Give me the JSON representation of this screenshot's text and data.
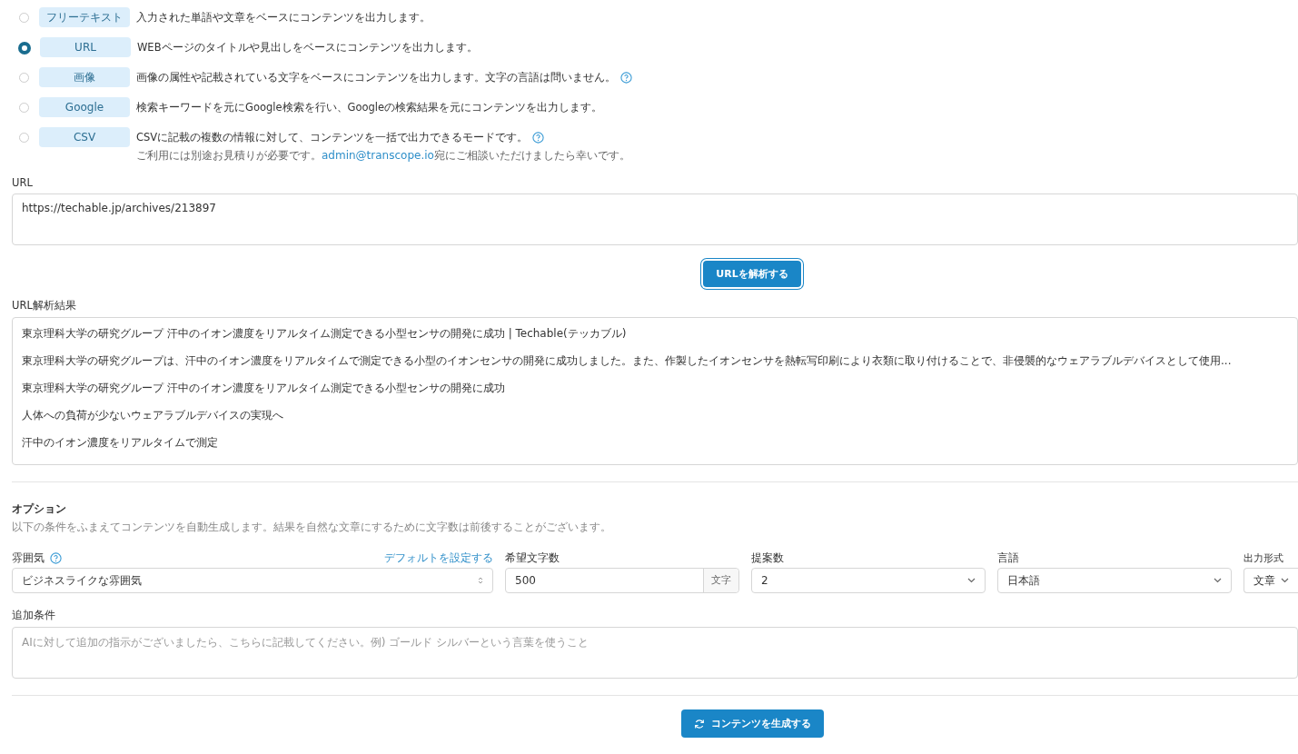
{
  "modes": [
    {
      "label": "フリーテキスト",
      "description": "入力された単語や文章をベースにコンテンツを出力します。",
      "selected": false,
      "help": false
    },
    {
      "label": "URL",
      "description": "WEBページのタイトルや見出しをベースにコンテンツを出力します。",
      "selected": true,
      "help": false
    },
    {
      "label": "画像",
      "description": "画像の属性や記載されている文字をベースにコンテンツを出力します。文字の言語は問いません。",
      "selected": false,
      "help": true
    },
    {
      "label": "Google",
      "description": "検索キーワードを元にGoogle検索を行い、Googleの検索結果を元にコンテンツを出力します。",
      "selected": false,
      "help": false
    },
    {
      "label": "CSV",
      "description": "CSVに記載の複数の情報に対して、コンテンツを一括で出力できるモードです。",
      "selected": false,
      "help": true,
      "note": {
        "before": "ご利用には別途お見積りが必要です。",
        "link": "admin@transcope.io",
        "after": "宛にご相談いただけましたら幸いです。"
      }
    }
  ],
  "url_field": {
    "label": "URL",
    "value": "https://techable.jp/archives/213897"
  },
  "analyze_button": {
    "label": "URLを解析する"
  },
  "analysis": {
    "label": "URL解析結果",
    "lines": [
      "東京理科大学の研究グループ 汗中のイオン濃度をリアルタイム測定できる小型センサの開発に成功 | Techable(テッカブル)",
      "東京理科大学の研究グループは、汗中のイオン濃度をリアルタイムで測定できる小型のイオンセンサの開発に成功しました。また、作製したイオンセンサを熱転写印刷により衣類に取り付けることで、非侵襲的なウェアラブルデバイスとして使用...",
      "東京理科大学の研究グループ 汗中のイオン濃度をリアルタイム測定できる小型センサの開発に成功",
      "人体への負荷が少ないウェアラブルデバイスの実現へ",
      "汗中のイオン濃度をリアルタイムで測定"
    ]
  },
  "options": {
    "title": "オプション",
    "description": "以下の条件をふまえてコンテンツを自動生成します。結果を自然な文章にするために文字数は前後することがございます。",
    "fields": [
      {
        "kind": "updown",
        "label": "雰囲気",
        "help": true,
        "link": "デフォルトを設定する",
        "value": "ビジネスライクな雰囲気"
      },
      {
        "kind": "number",
        "label": "希望文字数",
        "help": false,
        "value": "500",
        "unit": "文字"
      },
      {
        "kind": "select",
        "label": "提案数",
        "help": false,
        "value": "2"
      },
      {
        "kind": "select",
        "label": "言語",
        "help": false,
        "value": "日本語"
      },
      {
        "kind": "select",
        "label": "出力形式",
        "help": false,
        "value": "文章"
      }
    ]
  },
  "extra": {
    "label": "追加条件",
    "placeholder": "AIに対して追加の指示がございましたら、こちらに記載してください。例) ゴールド シルバーという言葉を使うこと"
  },
  "generate_button": {
    "label": "コンテンツを生成する"
  }
}
